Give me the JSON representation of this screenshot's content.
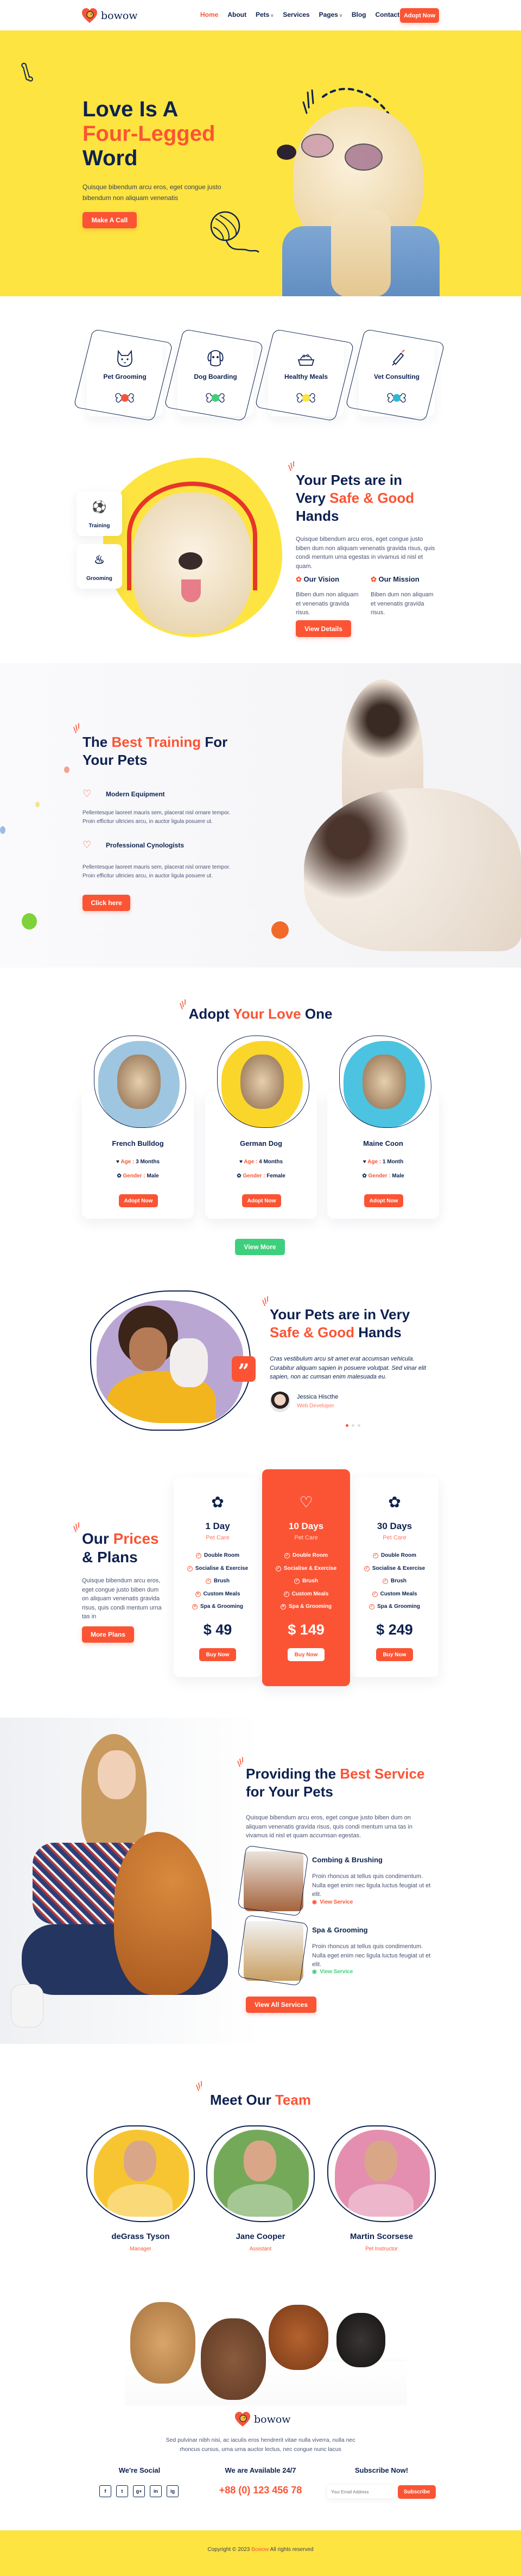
{
  "colors": {
    "navy": "#0d2150",
    "accent": "#fb5434",
    "yellow": "#fde440",
    "green": "#3ecf7c",
    "blue": "#2fb8d6"
  },
  "nav": {
    "brand": "bowow",
    "items": [
      {
        "label": "Home",
        "active": true
      },
      {
        "label": "About"
      },
      {
        "label": "Pets",
        "dropdown": true
      },
      {
        "label": "Services"
      },
      {
        "label": "Pages",
        "dropdown": true
      },
      {
        "label": "Blog"
      },
      {
        "label": "Contact"
      }
    ],
    "cta": "Adopt Now"
  },
  "hero": {
    "title_line1": "Love Is A",
    "title_highlight": "Four-Legged",
    "title_line3": "Word",
    "text": "Quisque bibendum arcu eros, eget congue justo bibendum non aliquam venenatis",
    "button": "Make A Call"
  },
  "features": [
    {
      "label": "Pet Grooming",
      "icon": "cat-icon",
      "bone_color": "#f4543a"
    },
    {
      "label": "Dog Boarding",
      "icon": "dog-icon",
      "bone_color": "#3ecf7c"
    },
    {
      "label": "Healthy Meals",
      "icon": "food-bowl-icon",
      "bone_color": "#fde440"
    },
    {
      "label": "Vet Consulting",
      "icon": "syringe-icon",
      "bone_color": "#2fb8d6"
    }
  ],
  "about": {
    "side_cards": [
      {
        "label": "Training",
        "icon": "balls-icon"
      },
      {
        "label": "Grooming",
        "icon": "bath-icon"
      }
    ],
    "title_a": "Your Pets are in",
    "title_b": "Very ",
    "title_highlight": "Safe & Good",
    "title_c": "Hands",
    "text": "Quisque bibendum arcu eros, eget congue justo biben dum non aliquam venenatis gravida risus, quis condi mentum urna egestas in vivamus id nisl et quam.",
    "vision": {
      "title": "Our Vision",
      "text": "Biben dum non aliquam et venenatis gravida risus."
    },
    "mission": {
      "title": "Our Mission",
      "text": "Biben dum non aliquam et venenatis gravida risus."
    },
    "button": "View Details"
  },
  "training": {
    "title_a": "The ",
    "title_highlight": "Best Training",
    "title_b": " For",
    "title_c": "Your Pets",
    "items": [
      {
        "title": "Modern Equipment",
        "text": "Pellentesque laoreet mauris sem, placerat nisl ornare tempor. Proin efficitur ultricies arcu, in auctor ligula posuere ut."
      },
      {
        "title": "Professional Cynologists",
        "text": "Pellentesque laoreet mauris sem, placerat nisl ornare tempor. Proin efficitur ultricies arcu, in auctor ligula posuere ut."
      }
    ],
    "button": "Click here"
  },
  "adopt": {
    "title_a": "Adopt ",
    "title_highlight": "Your Love",
    "title_b": " One",
    "age_label": "Age :",
    "gender_label": "Gender :",
    "pets": [
      {
        "name": "French Bulldog",
        "age": "3 Months",
        "gender": "Male",
        "bg": "#9ec6e0",
        "button": "Adopt Now"
      },
      {
        "name": "German Dog",
        "age": "4 Months",
        "gender": "Female",
        "bg": "#fbd62a",
        "button": "Adopt Now"
      },
      {
        "name": "Maine Coon",
        "age": "1 Month",
        "gender": "Male",
        "bg": "#4cc3e0",
        "button": "Adopt Now"
      }
    ],
    "more_button": "View More"
  },
  "testimonial": {
    "title_a": "Your Pets are in Very",
    "title_highlight": "Safe & Good",
    "title_b": " Hands",
    "quote": "Cras vestibulum arcu sit amet erat accumsan vehicula. Curabitur aliquam sapien in posuere volutpat. Sed vinar elit sapien, non ac cumsan enim malesuada eu.",
    "author": "Jessica Hiscthe",
    "role": "Web Developer",
    "slides": 3,
    "active_slide": 1
  },
  "pricing": {
    "title_a": "Our ",
    "title_highlight": "Prices",
    "title_b": "& Plans",
    "text": "Quisque bibendum arcu eros, eget congue justo biben dum on aliquam venenatis gravida risus, quis condi mentum urna tas in",
    "button": "More Plans",
    "plans": [
      {
        "title": "1 Day",
        "subtitle": "Pet Care",
        "price": "$ 49",
        "button": "Buy Now",
        "featured": false,
        "features": [
          {
            "label": "Double Room",
            "included": true
          },
          {
            "label": "Socialise & Exercise",
            "included": true
          },
          {
            "label": "Brush",
            "included": true
          },
          {
            "label": "Custom Meals",
            "included": false
          },
          {
            "label": "Spa & Grooming",
            "included": false
          }
        ]
      },
      {
        "title": "10 Days",
        "subtitle": "Pet Care",
        "price": "$ 149",
        "button": "Buy Now",
        "featured": true,
        "features": [
          {
            "label": "Double Room",
            "included": true
          },
          {
            "label": "Socialise & Exercise",
            "included": true
          },
          {
            "label": "Brush",
            "included": true
          },
          {
            "label": "Custom Meals",
            "included": true
          },
          {
            "label": "Spa & Grooming",
            "included": false
          }
        ]
      },
      {
        "title": "30 Days",
        "subtitle": "Pet Care",
        "price": "$ 249",
        "button": "Buy Now",
        "featured": false,
        "features": [
          {
            "label": "Double Room",
            "included": true
          },
          {
            "label": "Socialise & Exercise",
            "included": true
          },
          {
            "label": "Brush",
            "included": true
          },
          {
            "label": "Custom Meals",
            "included": true
          },
          {
            "label": "Spa & Grooming",
            "included": true
          }
        ]
      }
    ]
  },
  "services": {
    "title_a": "Providing the ",
    "title_highlight": "Best Service",
    "title_b": "for Your Pets",
    "text": "Quisque bibendum arcu eros, eget congue justo biben dum on aliquam venenatis gravida risus, quis condi mentum urna tas in vivamus id nisl et quam accumsan egestas.",
    "items": [
      {
        "title": "Combing & Brushing",
        "text": "Proin rhoncus at tellus quis condimentum. Nulla eget enim nec ligula luctus feugiat ut et elit.",
        "link": "View Service",
        "color": "#fb5434"
      },
      {
        "title": "Spa & Grooming",
        "text": "Proin rhoncus at tellus quis condimentum. Nulla eget enim nec ligula luctus feugiat ut et elit.",
        "link": "View Service",
        "color": "#3ecf7c"
      }
    ],
    "button": "View All Services"
  },
  "team": {
    "title_a": "Meet Our ",
    "title_highlight": "Team",
    "members": [
      {
        "name": "deGrass Tyson",
        "role": "Manager",
        "bg": "#f7c531"
      },
      {
        "name": "Jane Cooper",
        "role": "Assistant",
        "bg": "#74a95a"
      },
      {
        "name": "Martin Scorsese",
        "role": "Pet Instructor",
        "bg": "#e48fb0"
      }
    ]
  },
  "footer": {
    "brand": "bowow",
    "text": "Sed pulvinar nibh nisi, ac iaculis eros hendrerit vitae nulla viverra, nulla nec rhoncus cursus, urna urna auctor lectus, nec congue nunc lacus",
    "social_title": "We're Social",
    "socials": [
      {
        "label": "f",
        "icon": "facebook-icon"
      },
      {
        "label": "t",
        "icon": "twitter-icon"
      },
      {
        "label": "g+",
        "icon": "google-plus-icon"
      },
      {
        "label": "in",
        "icon": "linkedin-icon"
      },
      {
        "label": "ig",
        "icon": "instagram-icon"
      }
    ],
    "contact_title": "We are Available 24/7",
    "phone": "+88 (0) 123 456 78",
    "subscribe_title": "Subscribe Now!",
    "email_placeholder": "Your Email Address",
    "subscribe_button": "Subscribe",
    "copyright_a": "Copyright © 2023 ",
    "copyright_brand": "Bowow",
    "copyright_b": " All rights reserved"
  }
}
